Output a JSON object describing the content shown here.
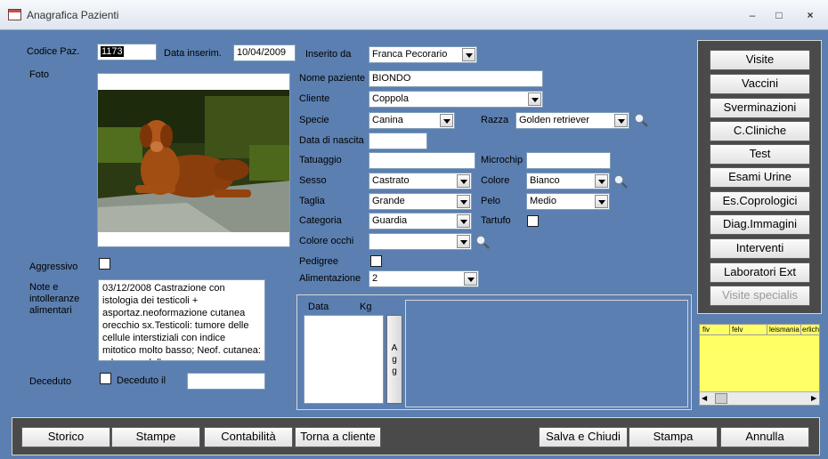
{
  "window": {
    "title": "Anagrafica Pazienti"
  },
  "labels": {
    "codice": "Codice Paz.",
    "data_inserim": "Data inserim.",
    "inserito_da": "Inserito da",
    "foto": "Foto",
    "nome": "Nome paziente",
    "cliente": "Cliente",
    "specie": "Specie",
    "razza": "Razza",
    "data_nascita": "Data di nascita",
    "tatuaggio": "Tatuaggio",
    "microchip": "Microchip",
    "sesso": "Sesso",
    "colore": "Colore",
    "taglia": "Taglia",
    "pelo": "Pelo",
    "categoria": "Categoria",
    "tartufo": "Tartufo",
    "colore_occhi": "Colore occhi",
    "pedigree": "Pedigree",
    "alimentazione": "Alimentazione",
    "aggressivo": "Aggressivo",
    "note": "Note e\nintolleranze\nalimentari",
    "deceduto": "Deceduto",
    "deceduto_il": "Deceduto il",
    "weight_data": "Data",
    "weight_kg": "Kg"
  },
  "fields": {
    "codice": "1173",
    "data_inserim": "10/04/2009",
    "inserito_da": "Franca Pecorario",
    "nome": "BIONDO",
    "cliente": "Coppola",
    "specie": "Canina",
    "razza": "Golden retriever",
    "data_nascita": "",
    "tatuaggio": "",
    "microchip": "",
    "sesso": "Castrato",
    "colore": "Bianco",
    "taglia": "Grande",
    "pelo": "Medio",
    "categoria": "Guardia",
    "colore_occhi": "",
    "alimentazione": "2",
    "deceduto_il": "",
    "note": "03/12/2008 Castrazione con istologia dei testicoli + asportaz.neoformazione cutanea orecchio sx.Testicoli: tumore delle cellule interstiziali con indice mitotico molto basso; Neof. cutanea: adenoma delle"
  },
  "agg_button": "A\ng\ng",
  "side_buttons": [
    "Visite",
    "Vaccini",
    "Sverminazioni",
    "C.Cliniche",
    "Test",
    "Esami Urine",
    "Es.Coprologici",
    "Diag.Immagini",
    "Interventi",
    "Laboratori Ext",
    "Visite specialis"
  ],
  "grid_columns": [
    "fiv",
    "felv",
    "leismania",
    "erlich"
  ],
  "bottom_buttons": {
    "storico": "Storico",
    "stampe": "Stampe",
    "contabilita": "Contabilità",
    "torna": "Torna a cliente",
    "salva": "Salva e Chiudi",
    "stampa": "Stampa",
    "annulla": "Annulla"
  },
  "icons": {
    "search": "search-icon",
    "dropdown": "chevron-down-icon"
  },
  "colors": {
    "form_bg": "#5b7fb0",
    "panel_bg": "#4a4a4a",
    "grid_bg": "#ffff66"
  }
}
